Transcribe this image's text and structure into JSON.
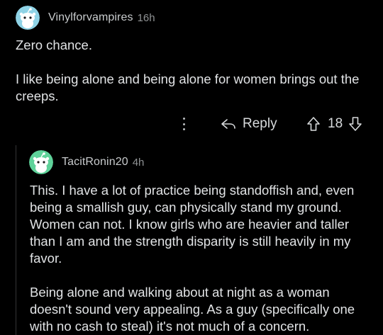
{
  "comment": {
    "username": "Vinylforvampires",
    "time": "16h",
    "paragraphs": [
      "Zero chance.",
      "I like being alone and being alone for women brings out the creeps."
    ],
    "actions": {
      "reply_label": "Reply",
      "score": "18"
    }
  },
  "reply": {
    "username": "TacitRonin20",
    "time": "4h",
    "paragraphs": [
      "This. I have a lot of practice being standoffish and, even being a smallish guy, can physically stand my ground. Women can not. I know girls who are heavier and taller than I am and the strength disparity is still heavily in my favor.",
      "Being alone and walking about at night as a woman doesn't sound very appealing. As a guy (specifically one with no cash to steal) it's not much of a concern."
    ]
  },
  "icons": {
    "avatar": "reddit-snoo-avatar-icon",
    "more": "more-options-icon",
    "reply": "reply-arrow-icon",
    "upvote": "upvote-arrow-icon",
    "downvote": "downvote-arrow-icon"
  },
  "colors": {
    "background": "#000000",
    "avatar_main": "#8fd3e6",
    "avatar_reply": "#5fd29a",
    "text": "#e1e3e5",
    "meta": "#8f9294"
  }
}
